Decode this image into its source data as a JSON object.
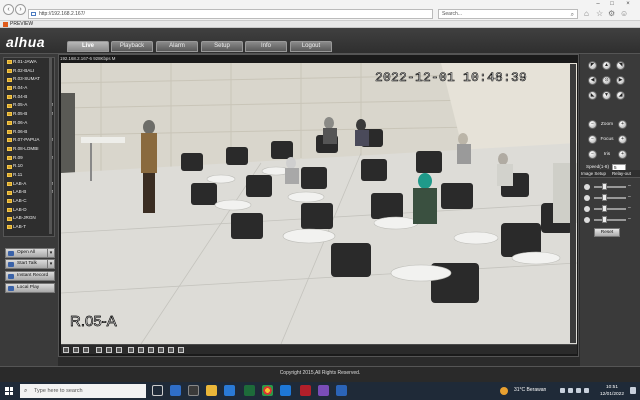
{
  "browser": {
    "url": "http://192.168.2.167/",
    "search_placeholder": "Search...",
    "tab_title": "PREVIEW",
    "back_icon": "back-arrow-icon",
    "forward_icon": "forward-arrow-icon"
  },
  "app": {
    "brand": "alhua",
    "tabs": [
      {
        "label": "Live",
        "active": true
      },
      {
        "label": "Playback",
        "active": false
      },
      {
        "label": "Alarm",
        "active": false
      },
      {
        "label": "Setup",
        "active": false
      },
      {
        "label": "Info",
        "active": false
      },
      {
        "label": "Logout",
        "active": false
      }
    ]
  },
  "channels": [
    {
      "label": "R.01-JAWA",
      "m": ""
    },
    {
      "label": "R.02-BALI",
      "m": ""
    },
    {
      "label": "R.03-SUMAT",
      "m": ""
    },
    {
      "label": "R.04-A",
      "m": ""
    },
    {
      "label": "R.04-B",
      "m": ""
    },
    {
      "label": "R.05-A",
      "m": "M"
    },
    {
      "label": "R.05-B",
      "m": "M"
    },
    {
      "label": "R.06-A",
      "m": ""
    },
    {
      "label": "R.06-B",
      "m": ""
    },
    {
      "label": "R.07-PAPUA",
      "m": "M"
    },
    {
      "label": "R.08-LOMBI",
      "m": ""
    },
    {
      "label": "R.09",
      "m": "M"
    },
    {
      "label": "R.10",
      "m": ""
    },
    {
      "label": "R.11",
      "m": ""
    },
    {
      "label": "LAB-A",
      "m": "M"
    },
    {
      "label": "LAB-B",
      "m": "M"
    },
    {
      "label": "LAB-C",
      "m": ""
    },
    {
      "label": "LAB-D",
      "m": ""
    },
    {
      "label": "LAB-JRGN",
      "m": ""
    },
    {
      "label": "LAB-T",
      "m": ""
    }
  ],
  "side_buttons": {
    "open_all": "Open All",
    "start_talk": "Start Talk",
    "instant_record": "Instant Record",
    "local_play": "Local Play"
  },
  "video": {
    "info": "192.168.2.167-6  928Kbps  M",
    "timestamp": "2022-12-01  10:48:39",
    "room_label": "R.05-A"
  },
  "ptz": {
    "zoom": "Zoom",
    "focus": "Focus",
    "iris": "Iris",
    "speed_label": "Speed(1-8)",
    "speed_value": "5"
  },
  "image_setup": {
    "tab1": "Image Setup",
    "tab2": "Relay-out",
    "reset": "Reset",
    "sliders": [
      {
        "icon": "brightness-icon",
        "level": 0.3
      },
      {
        "icon": "contrast-icon",
        "level": 0.3
      },
      {
        "icon": "hue-icon",
        "level": 0.3
      },
      {
        "icon": "saturation-icon",
        "level": 0.3
      }
    ]
  },
  "footer": {
    "copyright": "Copyright 2015,All Rights Reserved."
  },
  "taskbar": {
    "search_placeholder": "Type here to search",
    "weather": "31°C  Berawan",
    "time": "10:51",
    "date": "12/01/2022"
  }
}
